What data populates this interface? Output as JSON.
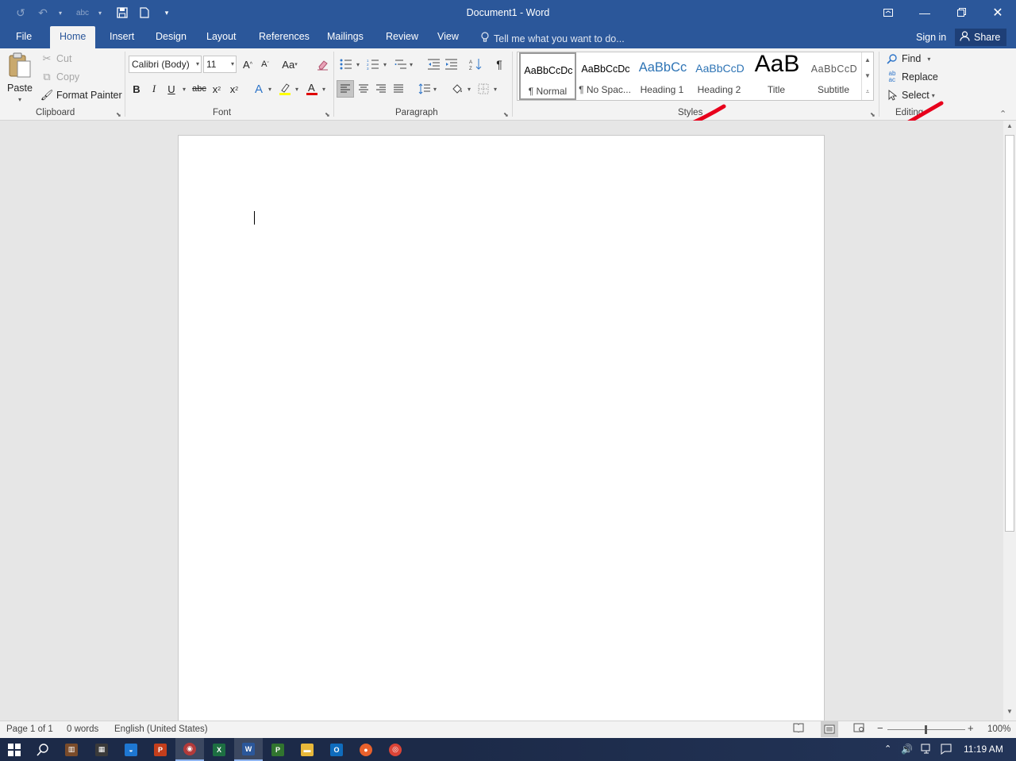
{
  "window": {
    "title": "Document1 - Word"
  },
  "tabs": [
    "File",
    "Home",
    "Insert",
    "Design",
    "Layout",
    "References",
    "Mailings",
    "Review",
    "View"
  ],
  "tell_me": "Tell me what you want to do...",
  "sign_in": "Sign in",
  "share": "Share",
  "clipboard": {
    "paste": "Paste",
    "cut": "Cut",
    "copy": "Copy",
    "format_painter": "Format Painter",
    "label": "Clipboard"
  },
  "font": {
    "name": "Calibri (Body)",
    "size": "11",
    "label": "Font",
    "change_case": "Aa"
  },
  "paragraph": {
    "label": "Paragraph"
  },
  "styles": {
    "label": "Styles",
    "items": [
      {
        "preview": "AaBbCcDc",
        "name": "¶ Normal"
      },
      {
        "preview": "AaBbCcDc",
        "name": "¶ No Spac..."
      },
      {
        "preview": "AaBbCc",
        "name": "Heading 1"
      },
      {
        "preview": "AaBbCcD",
        "name": "Heading 2"
      },
      {
        "preview": "AaB",
        "name": "Title"
      },
      {
        "preview": "AaBbCcD",
        "name": "Subtitle"
      }
    ]
  },
  "editing": {
    "find": "Find",
    "replace": "Replace",
    "select": "Select",
    "label": "Editing"
  },
  "status": {
    "page": "Page 1 of 1",
    "words": "0 words",
    "language": "English (United States)",
    "zoom": "100%"
  },
  "taskbar": {
    "time": "11:19 AM"
  },
  "colors": {
    "word_blue": "#2b579a",
    "ribbon_bg": "#f3f3f3",
    "annotation_red": "#e8001c"
  }
}
